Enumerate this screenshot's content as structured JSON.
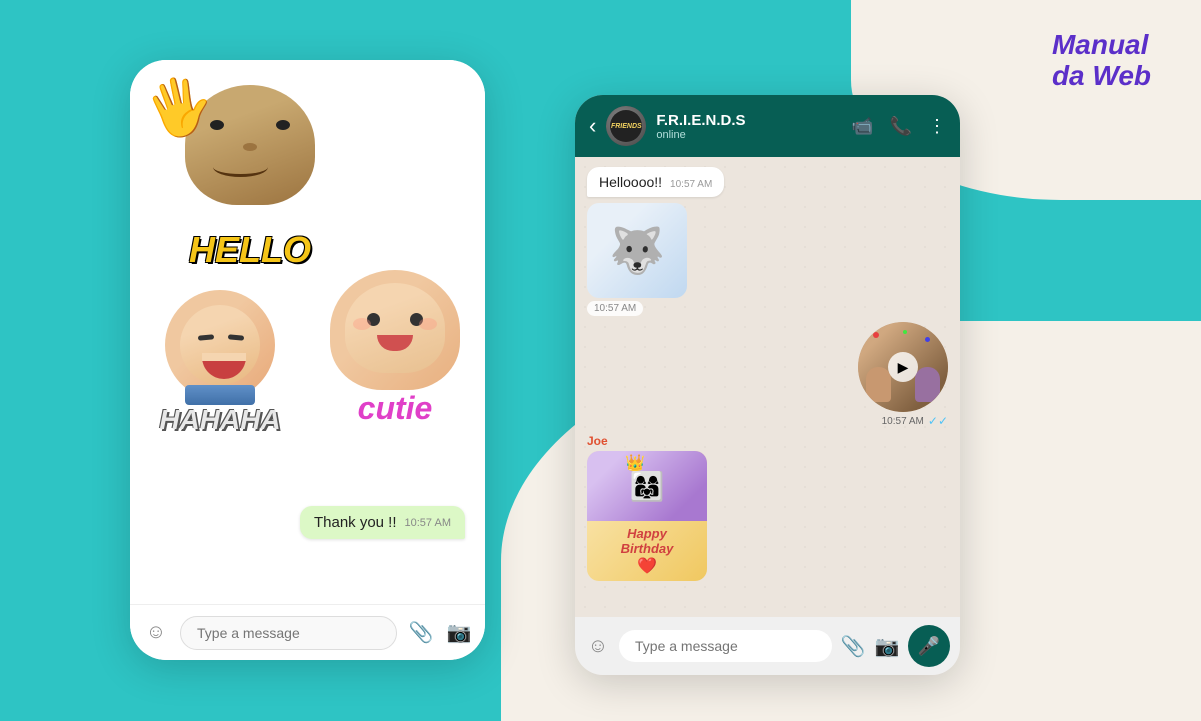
{
  "background": {
    "teal": "#2ec4c4",
    "cream": "#f5f0e8"
  },
  "logo": {
    "line1": "Manual",
    "line2": "da Web"
  },
  "left_phone": {
    "stickers": [
      {
        "id": "hello",
        "text": "HELLO",
        "emoji": "🤚"
      },
      {
        "id": "hahaha",
        "text": "HAHAHA"
      },
      {
        "id": "cutie",
        "text": "cutie"
      }
    ],
    "messages": [
      {
        "text": "Thank you !!",
        "time": "10:57 AM",
        "type": "outgoing"
      }
    ],
    "input_placeholder": "Type a message"
  },
  "right_phone": {
    "header": {
      "contact_name": "F.R.I.E.N.D.S",
      "status": "online",
      "back_label": "‹",
      "icons": [
        "video-icon",
        "phone-icon",
        "more-icon"
      ]
    },
    "messages": [
      {
        "text": "Helloooo!!",
        "time": "10:57 AM",
        "type": "incoming"
      },
      {
        "sticker": "dog",
        "time": "10:57 AM",
        "type": "sticker-in"
      },
      {
        "video": true,
        "time": "10:57 AM",
        "type": "outgoing-video",
        "ticks": "✓✓"
      },
      {
        "sender": "Joe",
        "sticker": "birthday",
        "time": "",
        "type": "sticker-sender"
      },
      {
        "hb": true
      }
    ],
    "input_placeholder": "Type a message"
  }
}
